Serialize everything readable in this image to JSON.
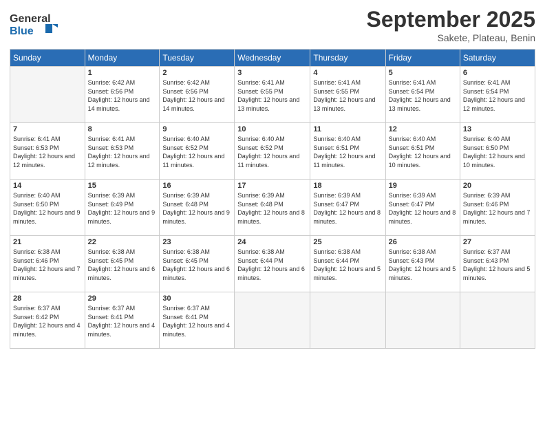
{
  "header": {
    "logo_general": "General",
    "logo_blue": "Blue",
    "month_title": "September 2025",
    "subtitle": "Sakete, Plateau, Benin"
  },
  "weekdays": [
    "Sunday",
    "Monday",
    "Tuesday",
    "Wednesday",
    "Thursday",
    "Friday",
    "Saturday"
  ],
  "weeks": [
    [
      {
        "day": "",
        "empty": true
      },
      {
        "day": "1",
        "sunrise": "Sunrise: 6:42 AM",
        "sunset": "Sunset: 6:56 PM",
        "daylight": "Daylight: 12 hours and 14 minutes."
      },
      {
        "day": "2",
        "sunrise": "Sunrise: 6:42 AM",
        "sunset": "Sunset: 6:56 PM",
        "daylight": "Daylight: 12 hours and 14 minutes."
      },
      {
        "day": "3",
        "sunrise": "Sunrise: 6:41 AM",
        "sunset": "Sunset: 6:55 PM",
        "daylight": "Daylight: 12 hours and 13 minutes."
      },
      {
        "day": "4",
        "sunrise": "Sunrise: 6:41 AM",
        "sunset": "Sunset: 6:55 PM",
        "daylight": "Daylight: 12 hours and 13 minutes."
      },
      {
        "day": "5",
        "sunrise": "Sunrise: 6:41 AM",
        "sunset": "Sunset: 6:54 PM",
        "daylight": "Daylight: 12 hours and 13 minutes."
      },
      {
        "day": "6",
        "sunrise": "Sunrise: 6:41 AM",
        "sunset": "Sunset: 6:54 PM",
        "daylight": "Daylight: 12 hours and 12 minutes."
      }
    ],
    [
      {
        "day": "7",
        "sunrise": "Sunrise: 6:41 AM",
        "sunset": "Sunset: 6:53 PM",
        "daylight": "Daylight: 12 hours and 12 minutes."
      },
      {
        "day": "8",
        "sunrise": "Sunrise: 6:41 AM",
        "sunset": "Sunset: 6:53 PM",
        "daylight": "Daylight: 12 hours and 12 minutes."
      },
      {
        "day": "9",
        "sunrise": "Sunrise: 6:40 AM",
        "sunset": "Sunset: 6:52 PM",
        "daylight": "Daylight: 12 hours and 11 minutes."
      },
      {
        "day": "10",
        "sunrise": "Sunrise: 6:40 AM",
        "sunset": "Sunset: 6:52 PM",
        "daylight": "Daylight: 12 hours and 11 minutes."
      },
      {
        "day": "11",
        "sunrise": "Sunrise: 6:40 AM",
        "sunset": "Sunset: 6:51 PM",
        "daylight": "Daylight: 12 hours and 11 minutes."
      },
      {
        "day": "12",
        "sunrise": "Sunrise: 6:40 AM",
        "sunset": "Sunset: 6:51 PM",
        "daylight": "Daylight: 12 hours and 10 minutes."
      },
      {
        "day": "13",
        "sunrise": "Sunrise: 6:40 AM",
        "sunset": "Sunset: 6:50 PM",
        "daylight": "Daylight: 12 hours and 10 minutes."
      }
    ],
    [
      {
        "day": "14",
        "sunrise": "Sunrise: 6:40 AM",
        "sunset": "Sunset: 6:50 PM",
        "daylight": "Daylight: 12 hours and 9 minutes."
      },
      {
        "day": "15",
        "sunrise": "Sunrise: 6:39 AM",
        "sunset": "Sunset: 6:49 PM",
        "daylight": "Daylight: 12 hours and 9 minutes."
      },
      {
        "day": "16",
        "sunrise": "Sunrise: 6:39 AM",
        "sunset": "Sunset: 6:48 PM",
        "daylight": "Daylight: 12 hours and 9 minutes."
      },
      {
        "day": "17",
        "sunrise": "Sunrise: 6:39 AM",
        "sunset": "Sunset: 6:48 PM",
        "daylight": "Daylight: 12 hours and 8 minutes."
      },
      {
        "day": "18",
        "sunrise": "Sunrise: 6:39 AM",
        "sunset": "Sunset: 6:47 PM",
        "daylight": "Daylight: 12 hours and 8 minutes."
      },
      {
        "day": "19",
        "sunrise": "Sunrise: 6:39 AM",
        "sunset": "Sunset: 6:47 PM",
        "daylight": "Daylight: 12 hours and 8 minutes."
      },
      {
        "day": "20",
        "sunrise": "Sunrise: 6:39 AM",
        "sunset": "Sunset: 6:46 PM",
        "daylight": "Daylight: 12 hours and 7 minutes."
      }
    ],
    [
      {
        "day": "21",
        "sunrise": "Sunrise: 6:38 AM",
        "sunset": "Sunset: 6:46 PM",
        "daylight": "Daylight: 12 hours and 7 minutes."
      },
      {
        "day": "22",
        "sunrise": "Sunrise: 6:38 AM",
        "sunset": "Sunset: 6:45 PM",
        "daylight": "Daylight: 12 hours and 6 minutes."
      },
      {
        "day": "23",
        "sunrise": "Sunrise: 6:38 AM",
        "sunset": "Sunset: 6:45 PM",
        "daylight": "Daylight: 12 hours and 6 minutes."
      },
      {
        "day": "24",
        "sunrise": "Sunrise: 6:38 AM",
        "sunset": "Sunset: 6:44 PM",
        "daylight": "Daylight: 12 hours and 6 minutes."
      },
      {
        "day": "25",
        "sunrise": "Sunrise: 6:38 AM",
        "sunset": "Sunset: 6:44 PM",
        "daylight": "Daylight: 12 hours and 5 minutes."
      },
      {
        "day": "26",
        "sunrise": "Sunrise: 6:38 AM",
        "sunset": "Sunset: 6:43 PM",
        "daylight": "Daylight: 12 hours and 5 minutes."
      },
      {
        "day": "27",
        "sunrise": "Sunrise: 6:37 AM",
        "sunset": "Sunset: 6:43 PM",
        "daylight": "Daylight: 12 hours and 5 minutes."
      }
    ],
    [
      {
        "day": "28",
        "sunrise": "Sunrise: 6:37 AM",
        "sunset": "Sunset: 6:42 PM",
        "daylight": "Daylight: 12 hours and 4 minutes."
      },
      {
        "day": "29",
        "sunrise": "Sunrise: 6:37 AM",
        "sunset": "Sunset: 6:41 PM",
        "daylight": "Daylight: 12 hours and 4 minutes."
      },
      {
        "day": "30",
        "sunrise": "Sunrise: 6:37 AM",
        "sunset": "Sunset: 6:41 PM",
        "daylight": "Daylight: 12 hours and 4 minutes."
      },
      {
        "day": "",
        "empty": true
      },
      {
        "day": "",
        "empty": true
      },
      {
        "day": "",
        "empty": true
      },
      {
        "day": "",
        "empty": true
      }
    ]
  ]
}
